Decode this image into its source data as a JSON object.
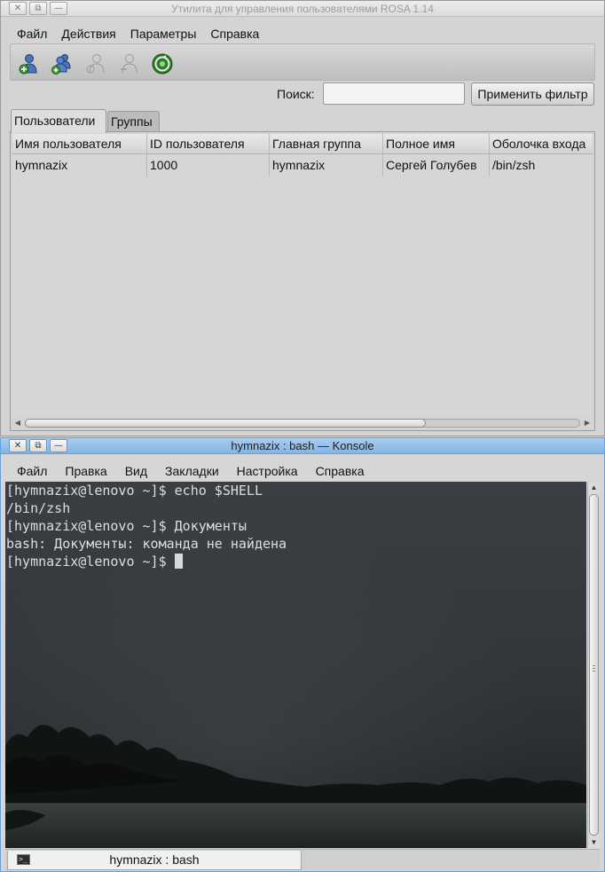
{
  "user_manager": {
    "title": "Утилита для управления пользователями ROSA 1.14",
    "menu": [
      "Файл",
      "Действия",
      "Параметры",
      "Справка"
    ],
    "toolbar": [
      {
        "icon": "add-user-icon",
        "enabled": true
      },
      {
        "icon": "add-group-icon",
        "enabled": true
      },
      {
        "icon": "edit-properties-icon",
        "enabled": false
      },
      {
        "icon": "delete-icon",
        "enabled": false
      },
      {
        "icon": "refresh-icon",
        "enabled": true
      }
    ],
    "search": {
      "label": "Поиск:",
      "value": "",
      "filter_button": "Применить фильтр"
    },
    "tabs": [
      {
        "label": "Пользователи",
        "active": true
      },
      {
        "label": "Группы",
        "active": false
      }
    ],
    "table": {
      "columns": [
        "Имя пользователя",
        "ID пользователя",
        "Главная группа",
        "Полное имя",
        "Оболочка входа"
      ],
      "rows": [
        [
          "hymnazix",
          "1000",
          "hymnazix",
          "Сергей Голубев",
          "/bin/zsh"
        ]
      ]
    }
  },
  "konsole": {
    "title": "hymnazix : bash — Konsole",
    "menu": [
      "Файл",
      "Правка",
      "Вид",
      "Закладки",
      "Настройка",
      "Справка"
    ],
    "lines": [
      "[hymnazix@lenovo ~]$ echo $SHELL",
      "/bin/zsh",
      "[hymnazix@lenovo ~]$ Документы",
      "bash: Документы: команда не найдена",
      "[hymnazix@lenovo ~]$ "
    ],
    "tab_label": "hymnazix : bash"
  },
  "window_buttons": {
    "close": "✕",
    "restore": "⧉",
    "minimize": "—"
  }
}
